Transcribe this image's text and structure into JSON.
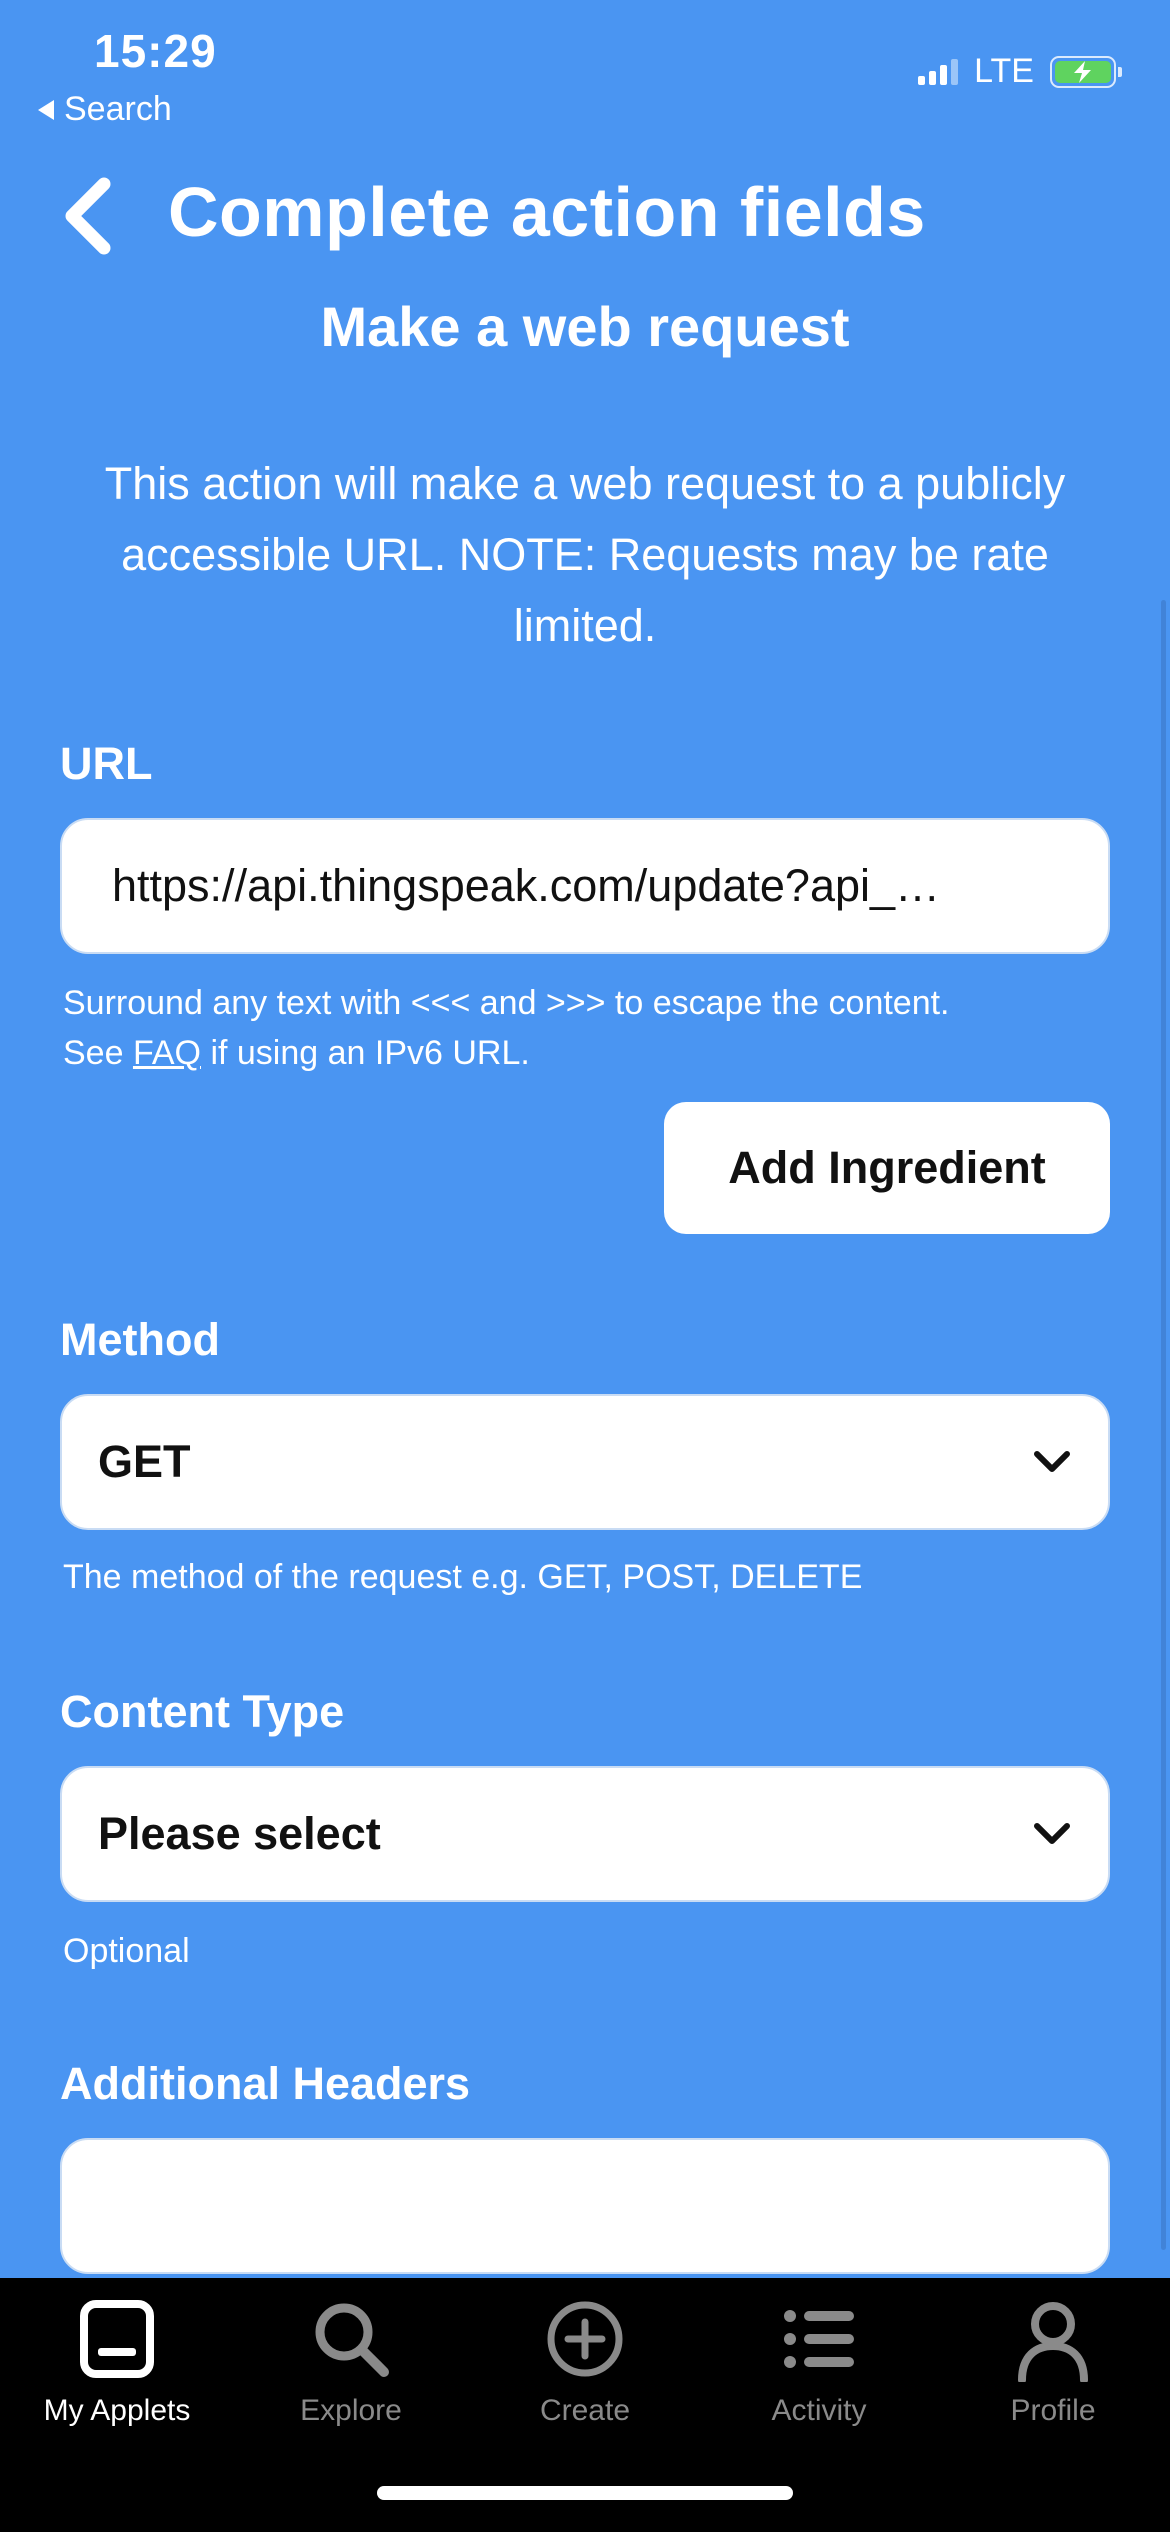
{
  "status_bar": {
    "time": "15:29",
    "back_app": "Search",
    "network": "LTE",
    "icons": [
      "signal-icon",
      "battery-charging-icon"
    ]
  },
  "header": {
    "title": "Complete action fields",
    "subtitle": "Make a web request",
    "description": "This action will make a web request to a publicly accessible URL. NOTE: Requests may be rate limited."
  },
  "fields": {
    "url": {
      "label": "URL",
      "value": "https://api.thingspeak.com/update?api_…",
      "help_line1": "Surround any text with <<< and >>> to escape the content.",
      "help_see": "See",
      "help_faq": "FAQ",
      "help_rest": "if using an IPv6 URL.",
      "add_ingredient": "Add Ingredient"
    },
    "method": {
      "label": "Method",
      "value": "GET",
      "help": "The method of the request e.g. GET, POST, DELETE"
    },
    "content_type": {
      "label": "Content Type",
      "value": "Please select",
      "help": "Optional"
    },
    "additional_headers": {
      "label": "Additional Headers",
      "value": ""
    }
  },
  "tabbar": {
    "tabs": [
      {
        "label": "My Applets",
        "icon": "my-applets-icon",
        "active": true
      },
      {
        "label": "Explore",
        "icon": "search-icon",
        "active": false
      },
      {
        "label": "Create",
        "icon": "plus-circle-icon",
        "active": false
      },
      {
        "label": "Activity",
        "icon": "list-icon",
        "active": false
      },
      {
        "label": "Profile",
        "icon": "person-icon",
        "active": false
      }
    ]
  },
  "colors": {
    "background": "#4a95f2",
    "field_bg": "#ffffff",
    "tabbar_bg": "#000000",
    "tab_inactive": "#8a8a8a",
    "battery_fill": "#5fd35f"
  }
}
